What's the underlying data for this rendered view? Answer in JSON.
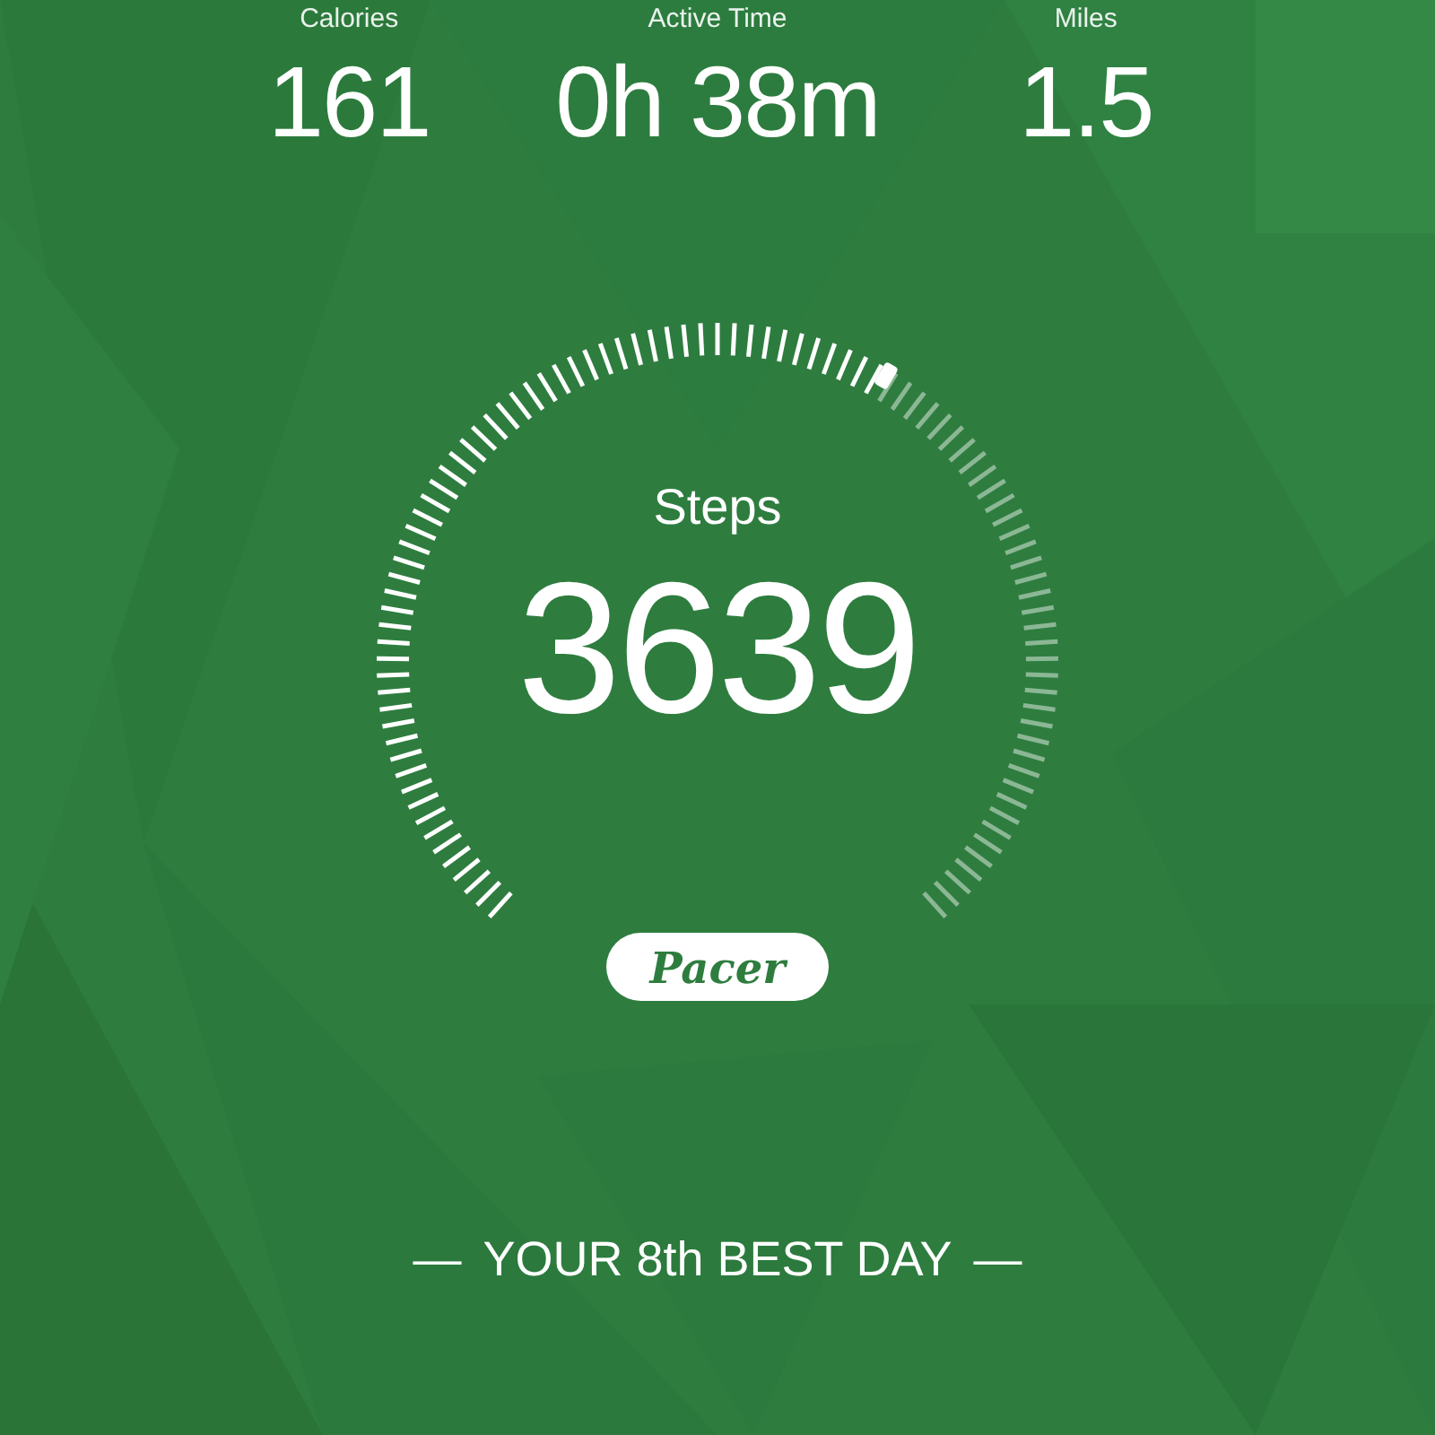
{
  "stats": [
    {
      "label": "Calories",
      "value": "161"
    },
    {
      "label": "Active Time",
      "value": "0h 38m"
    },
    {
      "label": "Miles",
      "value": "1.5"
    }
  ],
  "gauge": {
    "label": "Steps",
    "value": "3639"
  },
  "logo": "Pacer",
  "rank": {
    "dash": "—",
    "text": "YOUR 8th BEST DAY"
  }
}
